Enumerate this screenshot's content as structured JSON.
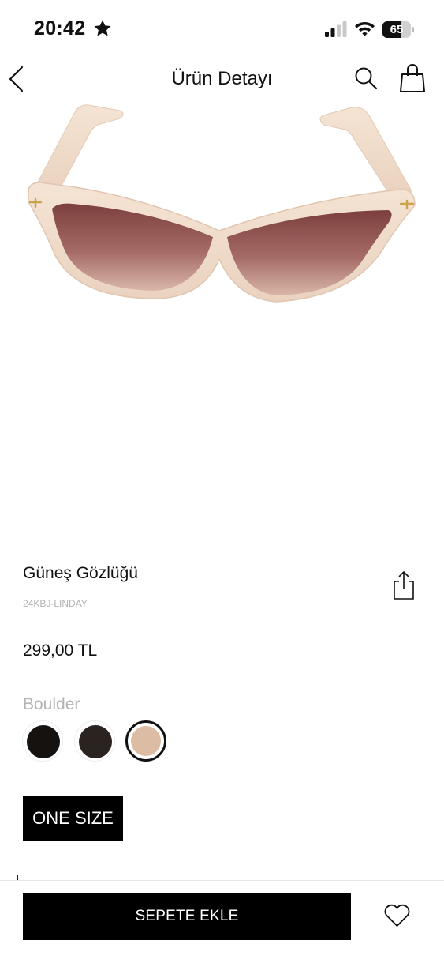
{
  "status_bar": {
    "time": "20:42",
    "battery": "65",
    "battery_level": 0.65,
    "icons": [
      "star-icon",
      "cellular-signal-icon",
      "wifi-icon",
      "battery-icon"
    ]
  },
  "header": {
    "title": "Ürün Detayı",
    "icons": [
      "chevron-left-icon",
      "search-icon",
      "shopping-bag-icon"
    ]
  },
  "product": {
    "name": "Güneş Gözlüğü",
    "code": "24KBJ-LINDAY",
    "price": "299,00 TL",
    "color_name": "Boulder",
    "swatches": [
      {
        "color": "#151210",
        "selected": false
      },
      {
        "color": "#2a2320",
        "selected": false
      },
      {
        "color": "#dcbca3",
        "selected": true
      }
    ],
    "size_label": "ONE SIZE"
  },
  "actions": {
    "add_to_cart_label": "SEPETE EKLE",
    "icons": [
      "share-icon",
      "heart-icon"
    ]
  },
  "colors": {
    "primary": "#000000",
    "muted_text": "#b3b3b3",
    "frame": "#f1dccb",
    "lens": "#8c5452"
  }
}
